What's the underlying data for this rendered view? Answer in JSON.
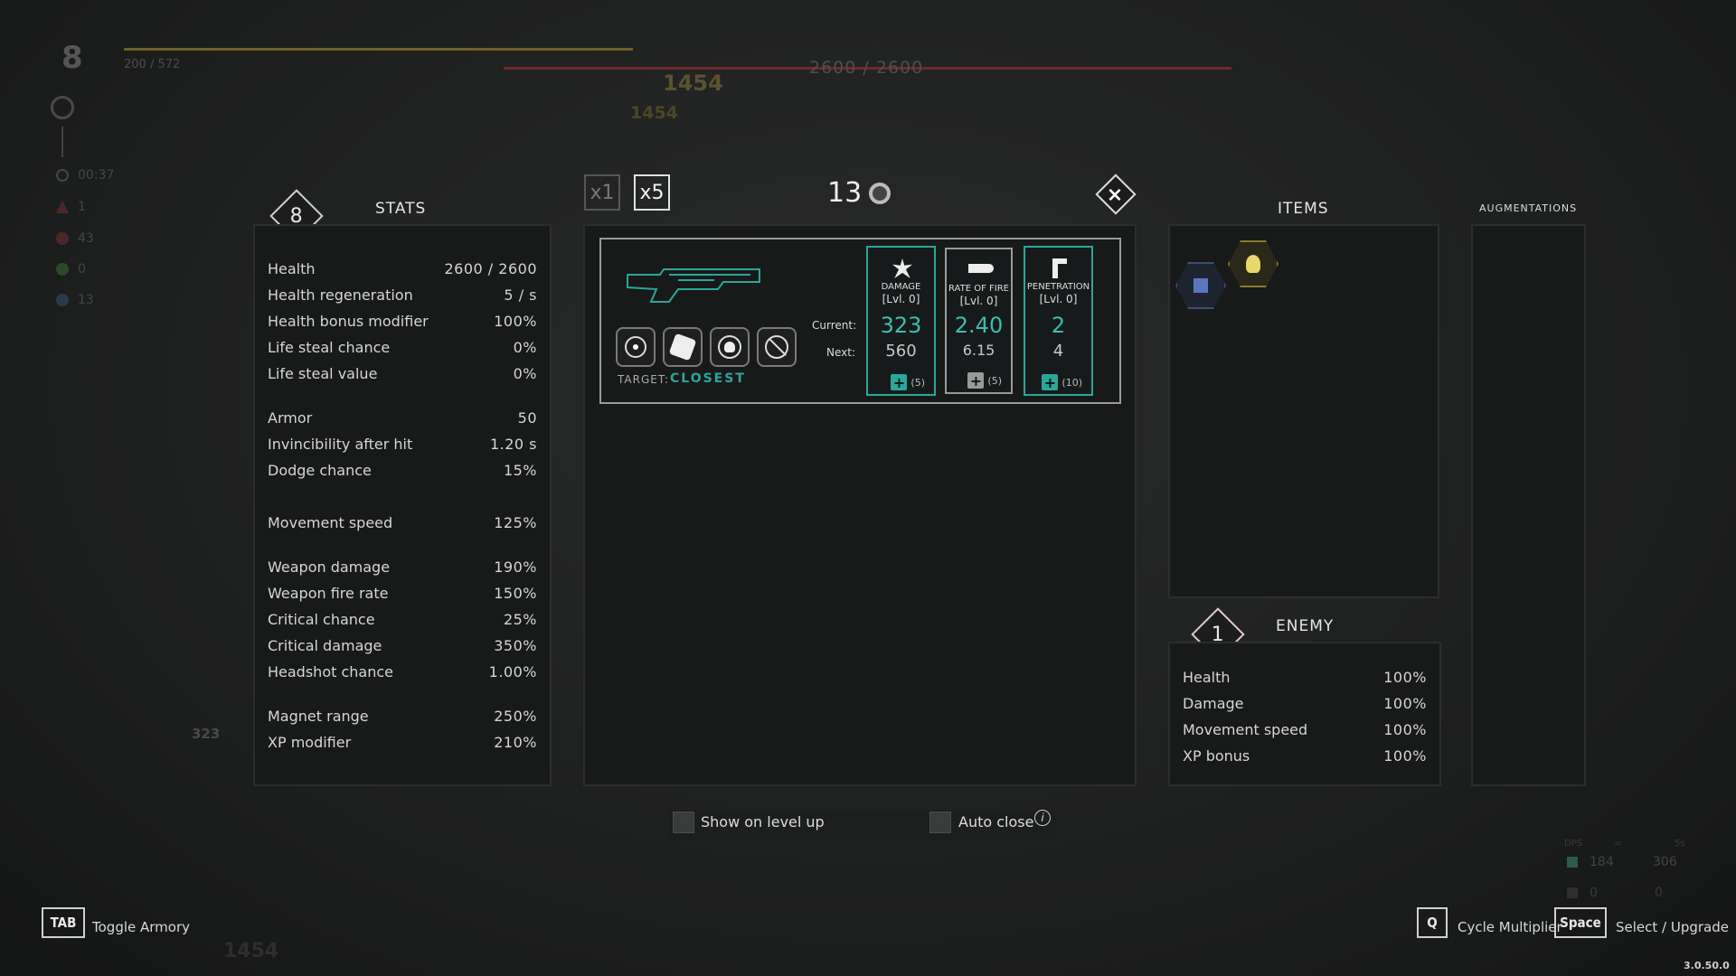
{
  "hud": {
    "level": "8",
    "xp_text": "200 / 572",
    "hp_text": "2600 / 2600",
    "damage_popups": [
      "1454",
      "1454",
      "1454",
      "323"
    ],
    "timer": "00:37",
    "counters": [
      "1",
      "43",
      "0",
      "13"
    ]
  },
  "stats": {
    "title": "STATS",
    "level": "8",
    "rows": [
      {
        "label": "Health",
        "value": "2600 / 2600"
      },
      {
        "label": "Health regeneration",
        "value": "5 / s"
      },
      {
        "label": "Health bonus modifier",
        "value": "100%"
      },
      {
        "label": "Life steal chance",
        "value": "0%"
      },
      {
        "label": "Life steal value",
        "value": "0%"
      },
      {
        "label": "Armor",
        "value": "50"
      },
      {
        "label": "Invincibility after hit",
        "value": "1.20 s"
      },
      {
        "label": "Dodge chance",
        "value": "15%"
      },
      {
        "label": "Movement speed",
        "value": "125%"
      },
      {
        "label": "Weapon damage",
        "value": "190%"
      },
      {
        "label": "Weapon fire rate",
        "value": "150%"
      },
      {
        "label": "Critical chance",
        "value": "25%"
      },
      {
        "label": "Critical damage",
        "value": "350%"
      },
      {
        "label": "Headshot chance",
        "value": "1.00%"
      },
      {
        "label": "Magnet range",
        "value": "250%"
      },
      {
        "label": "XP modifier",
        "value": "210%"
      }
    ]
  },
  "armory": {
    "multipliers": [
      "x1",
      "x5"
    ],
    "active_multiplier": "x5",
    "currency": "13",
    "close_label": "×",
    "target_label": "TARGET:",
    "target_value": "CLOSEST",
    "current_label": "Current:",
    "next_label": "Next:",
    "upgrades": [
      {
        "name": "DAMAGE",
        "level": "[Lvl. 0]",
        "current": "323",
        "next": "560",
        "cost": "(5)",
        "affordable": true
      },
      {
        "name": "RATE OF FIRE",
        "level": "[Lvl. 0]",
        "current": "2.40",
        "next": "6.15",
        "cost": "(5)",
        "affordable": false
      },
      {
        "name": "PENETRATION",
        "level": "[Lvl. 0]",
        "current": "2",
        "next": "4",
        "cost": "(10)",
        "affordable": true
      }
    ],
    "mod_icons": [
      "target-dot-icon",
      "dice-icon",
      "skull-crosshair-icon",
      "no-target-icon"
    ]
  },
  "items": {
    "title": "ITEMS",
    "owned": [
      "snowflake-chip-icon",
      "golden-bulb-icon"
    ]
  },
  "augmentations": {
    "title": "AUGMENTATIONS"
  },
  "enemy": {
    "title": "ENEMY",
    "level": "1",
    "rows": [
      {
        "label": "Health",
        "value": "100%"
      },
      {
        "label": "Damage",
        "value": "100%"
      },
      {
        "label": "Movement speed",
        "value": "100%"
      },
      {
        "label": "XP bonus",
        "value": "100%"
      }
    ]
  },
  "options": {
    "show_on_level_up": "Show on level up",
    "auto_close": "Auto close"
  },
  "dps": {
    "header_dps": "DPS",
    "header_inf": "∞",
    "header_5s": "5s",
    "row1": [
      "184",
      "306"
    ],
    "row2": [
      "0",
      "0"
    ]
  },
  "controls": {
    "tab_key": "TAB",
    "tab_label": "Toggle Armory",
    "q_key": "Q",
    "q_label": "Cycle Multiplier",
    "space_key": "Space",
    "space_label": "Select / Upgrade"
  },
  "version": "3.0.50.0",
  "colors": {
    "accent_teal": "#2aa69a",
    "value_teal": "#3dbdb0",
    "xp_bar": "#6e6228",
    "hp_bar": "#6e2a2a"
  }
}
